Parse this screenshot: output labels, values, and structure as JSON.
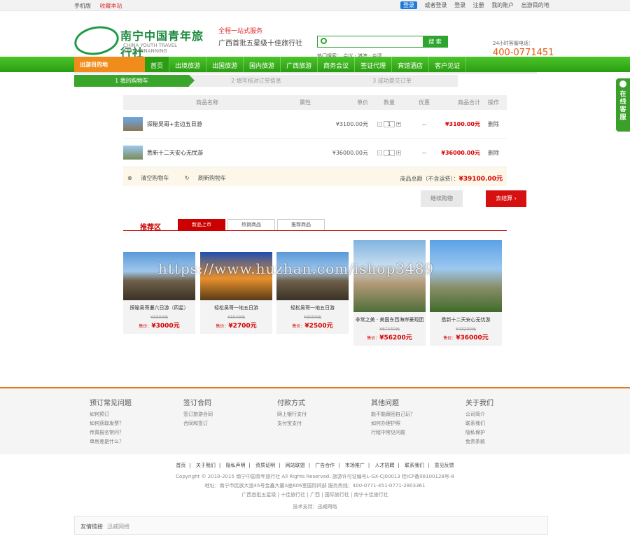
{
  "topbar": {
    "mobile": "手机版",
    "favorite": "收藏本站",
    "login": "登录",
    "quick_login": "或者登录",
    "register_1": "登录",
    "register_2": "注册",
    "account": "我的账户",
    "departure": "出游目的地"
  },
  "header": {
    "logo_cn": "南宁中国青年旅行社",
    "logo_en": "CHINA YOUTH TRAVEL SERVICENANNING",
    "slogan": "全程一站式服务",
    "slogan2": "广西首批五星级十佳旅行社",
    "search_btn": "搜 索",
    "hot": "热门搜索：  会议  ·  港澳  ·  台湾",
    "hotline_label": "24小时客服电话：",
    "tel": "400-0771451"
  },
  "nav": {
    "dest": "出游目的地",
    "items": [
      "首页",
      "出境旅游",
      "出国旅游",
      "国内旅游",
      "广西旅游",
      "商务会议",
      "签证代理",
      "宾馆酒店",
      "客户见证"
    ]
  },
  "steps": [
    "1 我的购物车",
    "2 填写核对订单信息",
    "3 成功提交订单"
  ],
  "cart": {
    "headers": [
      "商品名称",
      "属性",
      "单价",
      "数量",
      "优惠",
      "商品合计",
      "操作"
    ],
    "rows": [
      {
        "name": "探秘吴哥+金边五日游",
        "price": "¥3100.00元",
        "qty": "1",
        "discount": "--",
        "total": "¥3100.00元",
        "op": "删除"
      },
      {
        "name": "悉新十二天安心无忧游",
        "price": "¥36000.00元",
        "qty": "1",
        "discount": "--",
        "total": "¥36000.00元",
        "op": "删除"
      }
    ],
    "clear": "清空购物车",
    "refresh": "刷新购物车",
    "sum_label": "商品总额（不含运费）：",
    "sum": "¥39100.00元"
  },
  "actions": {
    "continue": "继续购物",
    "checkout": "去结算 ›"
  },
  "recommend": {
    "title": "推荐区",
    "tabs": [
      "新品上市",
      "热销商品",
      "推荐商品"
    ]
  },
  "products": [
    {
      "name": "探秘吴哥暹六日游（四星）",
      "op": "¥3300元",
      "sp_label": "售价：",
      "sp": "¥3000元"
    },
    {
      "name": "轻松吴哥一地五日游",
      "op": "¥3040元",
      "sp_label": "售价：",
      "sp": "¥2700元"
    },
    {
      "name": "轻松吴哥一地五日游",
      "op": "¥3000元",
      "sp_label": "售价：",
      "sp": "¥2500元"
    },
    {
      "name": "非常之美 · 美国东西海岸豪观团",
      "op": "¥67440元",
      "sp_label": "售价：",
      "sp": "¥56200元"
    },
    {
      "name": "悉新十二天安心无忧游",
      "op": "¥43200元",
      "sp_label": "售价：",
      "sp": "¥36000元"
    }
  ],
  "watermark": "https://www.huzhan.com/ishop3489",
  "footer": {
    "cols": [
      {
        "title": "预订常见问题",
        "items": [
          "如何预订",
          "如何获取发票？",
          "传真报名常问？",
          "单房差是什么？"
        ]
      },
      {
        "title": "签订合同",
        "items": [
          "签订旅游合同",
          "合同和签订"
        ]
      },
      {
        "title": "付款方式",
        "items": [
          "网上银行支付",
          "支付宝支付"
        ]
      },
      {
        "title": "其他问题",
        "items": [
          "能不能跟团自己玩？",
          "如何办理护照",
          "行程中常见问题"
        ]
      },
      {
        "title": "关于我们",
        "items": [
          "公司简介",
          "联系我们",
          "隐私保护",
          "免责条款"
        ]
      }
    ],
    "links": [
      "首页",
      "关于我们",
      "隐私声明",
      "资质证明",
      "网站联盟",
      "广告合作",
      "市场推广",
      "人才招聘",
      "联系我们",
      "意见反馈"
    ],
    "copyright": "Copyright © 2010-2015 南宁中国青年旅行社 All Rights Reserved. 旅游许可证编号L-GX-CJ00013   桂ICP备08100128号-8",
    "address": "地址：南宁市民族大道45号金鑫大厦A座606室国际间部 服务热线：400-0771-451-0771-2803361",
    "brands": "广西首批五星级 | 十佳旅行社 | 广西 | 国际旅行社 | 南宁十佳旅行社",
    "support": "技术支持：迅威网络",
    "friend_label": "友情链接",
    "friend_item": "迅威网络"
  },
  "side": "在线客服"
}
